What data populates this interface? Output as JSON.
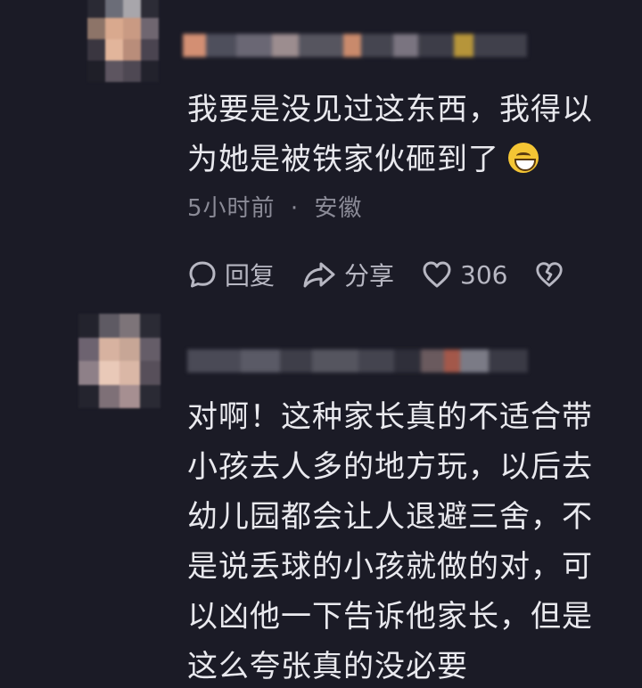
{
  "comments": [
    {
      "text_lines": [
        "我要是没见过这东西，我得以",
        "为她是被铁家伙砸到了"
      ],
      "emoji": "grinning-sweat-emoji",
      "time": "5小时前",
      "separator": "·",
      "location": "安徽",
      "actions": {
        "reply_label": "回复",
        "share_label": "分享",
        "like_count": "306"
      }
    },
    {
      "text_lines": [
        "对啊！这种家长真的不适合带",
        "小孩去人多的地方玩，以后去",
        "幼儿园都会让人退避三舍，不",
        "是说丢球的小孩就做的对，可",
        "以凶他一下告诉他家长，但是",
        "这么夸张真的没必要"
      ]
    }
  ],
  "colors": {
    "background": "#1b1b26",
    "text": "#e9e9ee",
    "meta": "#8b8b97",
    "action": "#b7b7c2"
  }
}
